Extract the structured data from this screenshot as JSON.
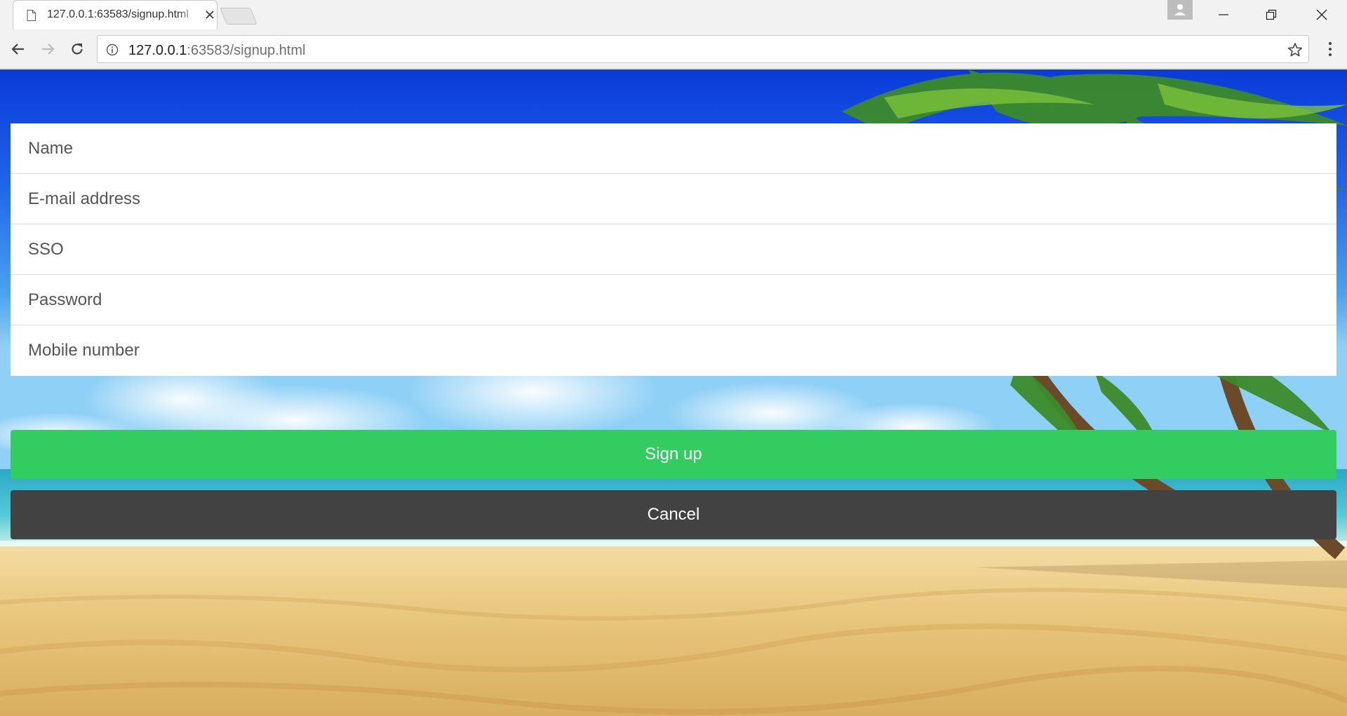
{
  "browser": {
    "tab_title": "127.0.0.1:63583/signup.html",
    "url_host": "127.0.0.1",
    "url_rest": ":63583/signup.html"
  },
  "form": {
    "fields": [
      {
        "placeholder": "Name",
        "value": ""
      },
      {
        "placeholder": "E-mail address",
        "value": ""
      },
      {
        "placeholder": "SSO",
        "value": ""
      },
      {
        "placeholder": "Password",
        "value": ""
      },
      {
        "placeholder": "Mobile number",
        "value": ""
      }
    ]
  },
  "buttons": {
    "signup_label": "Sign up",
    "cancel_label": "Cancel"
  },
  "colors": {
    "signup": "#33cc60",
    "cancel": "#424242",
    "sky": "#1a50e0",
    "sand": "#e9c77e"
  }
}
